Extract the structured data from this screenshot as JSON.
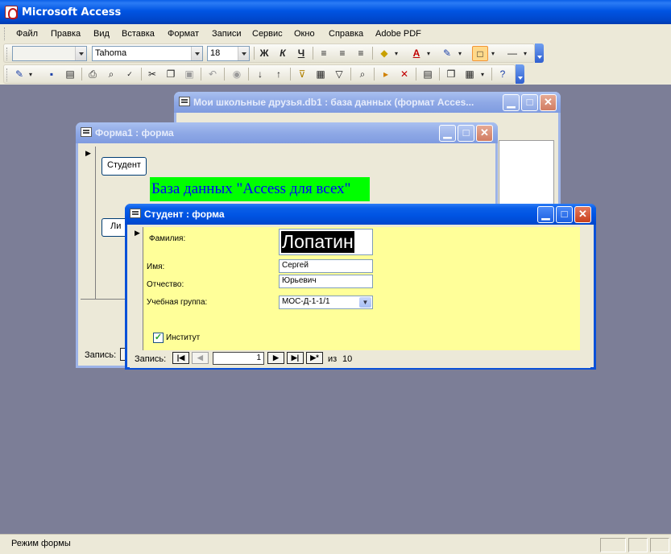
{
  "app": {
    "title": "Microsoft Access"
  },
  "menu": [
    "Файл",
    "Правка",
    "Вид",
    "Вставка",
    "Формат",
    "Записи",
    "Сервис",
    "Окно",
    "Справка",
    "Adobe PDF"
  ],
  "format_toolbar": {
    "object_combo": "",
    "font_combo": "Tahoma",
    "size_combo": "18",
    "bold": "Ж",
    "italic": "К",
    "underline": "Ч",
    "font_color_letter": "A"
  },
  "db_window": {
    "title": "Мои школьные друзья.db1 : база данных (формат Acces..."
  },
  "form1": {
    "title": "Форма1 : форма",
    "student_button": "Студент",
    "banner": "База данных \"Access для всех\"",
    "partial_button": "Ли",
    "record_label": "Запись:"
  },
  "student_form": {
    "title": "Студент : форма",
    "surname_label": "Фамилия:",
    "surname_value": "Лопатин",
    "name_label": "Имя:",
    "name_value": "Сергей",
    "patronymic_label": "Отчество:",
    "patronymic_value": "Юрьевич",
    "group_label": "Учебная группа:",
    "group_value": "МОС-Д-1-1/1",
    "institute_label": "Институт",
    "institute_checked": true
  },
  "record_nav": {
    "label": "Запись:",
    "current": "1",
    "of_label": "из",
    "total": "10"
  },
  "status": {
    "text": "Режим формы"
  },
  "colors": {
    "mdi_background": "#7c7e97",
    "form_detail": "#ffff99",
    "banner_background": "#00ff00",
    "banner_text": "#0000ff",
    "title_active": "#0054e3"
  }
}
